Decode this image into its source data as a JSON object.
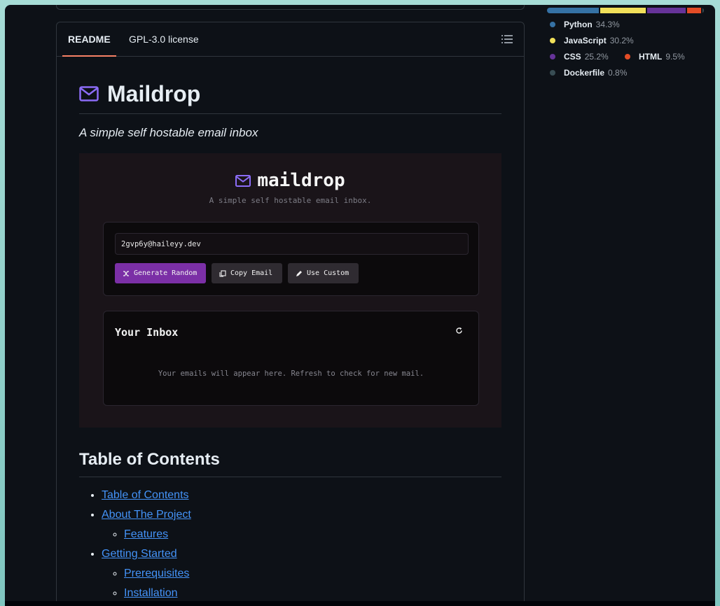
{
  "readme": {
    "tabs": [
      "README",
      "GPL-3.0 license"
    ],
    "title": "Maildrop",
    "tagline": "A simple self hostable email inbox"
  },
  "preview": {
    "logo_text": "maildrop",
    "subtitle": "A simple self hostable email inbox.",
    "email_value": "2gvp6y@haileyy.dev",
    "buttons": {
      "generate": "Generate Random",
      "copy": "Copy Email",
      "custom": "Use Custom"
    },
    "inbox_title": "Your Inbox",
    "inbox_empty": "Your emails will appear here. Refresh to check for new mail.",
    "accent_color": "#7b2fa6"
  },
  "toc": {
    "heading": "Table of Contents",
    "items": [
      {
        "label": "Table of Contents",
        "children": []
      },
      {
        "label": "About The Project",
        "children": [
          "Features"
        ]
      },
      {
        "label": "Getting Started",
        "children": [
          "Prerequisites",
          "Installation"
        ]
      }
    ]
  },
  "languages": [
    {
      "name": "Python",
      "pct": "34.3%",
      "value": 34.3,
      "color": "#3572A5"
    },
    {
      "name": "JavaScript",
      "pct": "30.2%",
      "value": 30.2,
      "color": "#f1e05a"
    },
    {
      "name": "CSS",
      "pct": "25.2%",
      "value": 25.2,
      "color": "#663399"
    },
    {
      "name": "HTML",
      "pct": "9.5%",
      "value": 9.5,
      "color": "#e34c26"
    },
    {
      "name": "Dockerfile",
      "pct": "0.8%",
      "value": 0.8,
      "color": "#384d54"
    }
  ]
}
